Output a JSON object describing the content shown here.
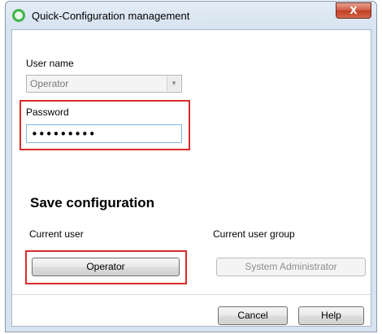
{
  "window": {
    "title": "Quick-Configuration management",
    "close_glyph": "X"
  },
  "login": {
    "username_label": "User name",
    "username_value": "Operator",
    "password_label": "Password",
    "password_mask": "•••••••••"
  },
  "save": {
    "title": "Save configuration",
    "current_user_label": "Current user",
    "current_user_button": "Operator",
    "current_group_label": "Current user group",
    "current_group_button": "System Administrator"
  },
  "footer": {
    "cancel_label": "Cancel",
    "help_label": "Help"
  },
  "icons": {
    "app": "green-ring-icon",
    "close": "close-icon",
    "dropdown": "chevron-down-icon"
  },
  "colors": {
    "highlight": "#dc2a2a",
    "app_icon": "#3fb449",
    "close_button": "#c94a31"
  }
}
